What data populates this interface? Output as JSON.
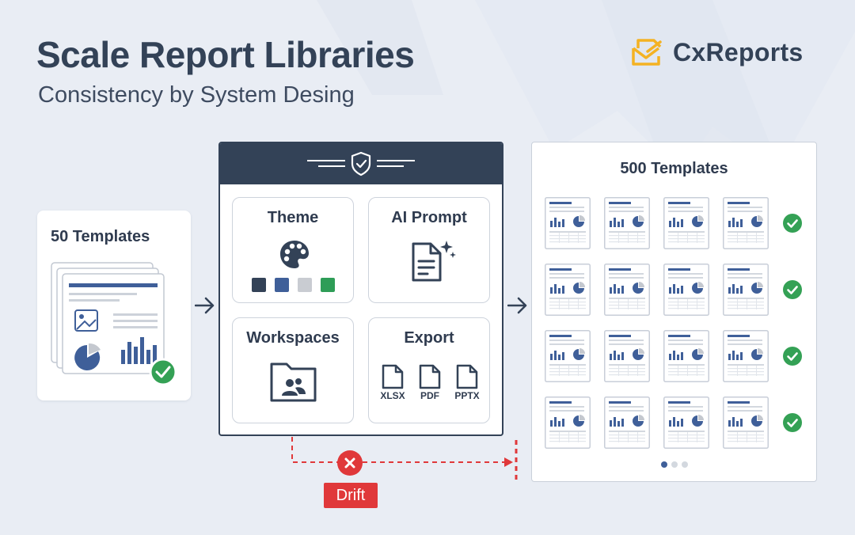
{
  "header": {
    "title": "Scale Report Libraries",
    "subtitle": "Consistency by System Desing"
  },
  "brand": {
    "name": "CxReports"
  },
  "source": {
    "label": "50 Templates"
  },
  "system": {
    "tiles": [
      {
        "label": "Theme",
        "icon": "palette-icon",
        "swatches": [
          "#334257",
          "#3f5f99",
          "#c9ccd2",
          "#2e9d57"
        ]
      },
      {
        "label": "AI Prompt",
        "icon": "document-sparkle-icon"
      },
      {
        "label": "Workspaces",
        "icon": "folder-users-icon"
      },
      {
        "label": "Export",
        "icon": "file-icon",
        "formats": [
          "XLSX",
          "PDF",
          "PPTX"
        ]
      }
    ]
  },
  "drift": {
    "label": "Drift"
  },
  "output": {
    "label": "500 Templates",
    "rows": 4,
    "per_row": 4
  },
  "colors": {
    "dark": "#334257",
    "accent": "#3f5f99",
    "success": "#34a155",
    "danger": "#e0383a",
    "brand_yellow": "#f4b223"
  }
}
